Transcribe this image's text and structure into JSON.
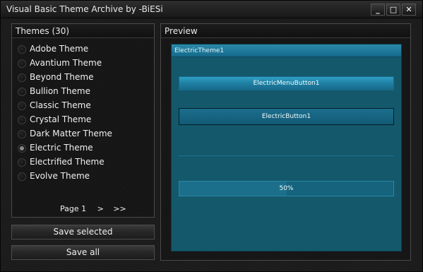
{
  "window": {
    "title": "Visual Basic Theme Archive by -BiESi",
    "buttons": {
      "minimize": "_",
      "maximize": "□",
      "close": "✕"
    }
  },
  "themes_panel": {
    "header": "Themes (30)",
    "items": [
      {
        "label": "Adobe Theme",
        "checked": false
      },
      {
        "label": "Avantium Theme",
        "checked": false
      },
      {
        "label": "Beyond Theme",
        "checked": false
      },
      {
        "label": "Bullion Theme",
        "checked": false
      },
      {
        "label": "Classic Theme",
        "checked": false
      },
      {
        "label": "Crystal Theme",
        "checked": false
      },
      {
        "label": "Dark Matter Theme",
        "checked": false
      },
      {
        "label": "Electric Theme",
        "checked": true
      },
      {
        "label": "Electrified Theme",
        "checked": false
      },
      {
        "label": "Evolve Theme",
        "checked": false
      }
    ],
    "pager": {
      "page_label": "Page 1",
      "next": ">",
      "last": ">>"
    }
  },
  "actions": {
    "save_selected": "Save selected",
    "save_all": "Save all"
  },
  "preview_panel": {
    "header": "Preview",
    "form_title": "ElectricTheme1",
    "menu_button": "ElectricMenuButton1",
    "button": "ElectricButton1",
    "progress": {
      "value": 0.5,
      "label": "50%"
    }
  },
  "colors": {
    "electric_accent": "#2fa0c4",
    "electric_background": "#14586b"
  }
}
